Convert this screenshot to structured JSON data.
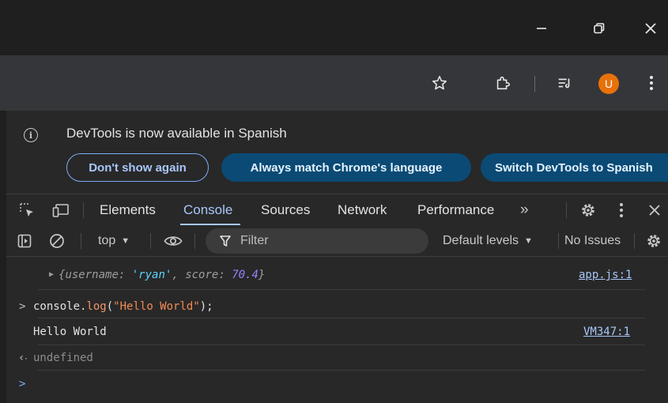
{
  "browser": {
    "window_controls": {
      "minimize_icon": "minimize-icon",
      "restore_icon": "restore-icon",
      "close_icon": "close-icon"
    },
    "toolbar": {
      "avatar_letter": "U",
      "avatar_color": "#e8710a"
    }
  },
  "infobar": {
    "message": "DevTools is now available in Spanish",
    "dont_show": "Don't show again",
    "always_match": "Always match Chrome's language",
    "switch": "Switch DevTools to Spanish"
  },
  "tabs": {
    "elements": "Elements",
    "console": "Console",
    "sources": "Sources",
    "network": "Network",
    "performance": "Performance",
    "more": "»",
    "active": "Console"
  },
  "console_toolbar": {
    "context": "top",
    "filter_placeholder": "Filter",
    "levels": "Default levels",
    "issues": "No Issues"
  },
  "console": {
    "object_line": {
      "open": "{",
      "key1": "username:",
      "val1": "'ryan'",
      "comma": ",",
      "key2": "score:",
      "val2": "70.4",
      "close": "}",
      "source": "app.js:1"
    },
    "input_line": {
      "prefix": "console.",
      "method": "log",
      "paren_open": "(",
      "string": "\"Hello World\"",
      "paren_close": ");"
    },
    "output_line": {
      "text": "Hello World",
      "source": "VM347:1"
    },
    "return_line": {
      "text": "undefined"
    }
  }
}
